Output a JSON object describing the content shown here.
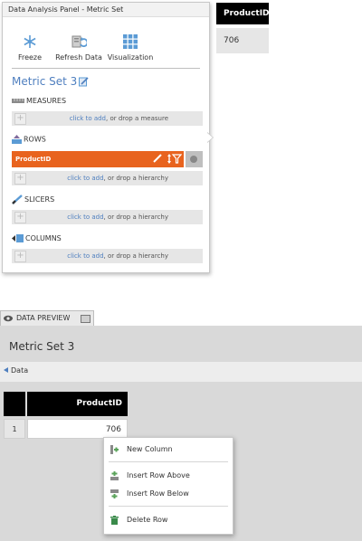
{
  "panel": {
    "title": "Data Analysis Panel - Metric Set",
    "toolbar": [
      {
        "label": "Freeze",
        "icon": "snowflake-icon"
      },
      {
        "label": "Refresh Data",
        "icon": "refresh-data-icon"
      },
      {
        "label": "Visualization",
        "icon": "visualization-grid-icon"
      }
    ],
    "metric_set_name": "Metric Set 3",
    "sections": {
      "measures": {
        "label": "MEASURES",
        "link": "click to add",
        "rest": ", or drop a measure"
      },
      "rows": {
        "label": "ROWS",
        "link": "click to add",
        "rest": ", or drop a hierarchy",
        "item": "ProductID"
      },
      "slicers": {
        "label": "SLICERS",
        "link": "click to add",
        "rest": ", or drop a hierarchy"
      },
      "columns": {
        "label": "COLUMNS",
        "link": "click to add",
        "rest": ", or drop a hierarchy"
      }
    },
    "accent": "#e8631e",
    "link_color": "#4f7fbf"
  },
  "mini_table": {
    "header": "ProductID",
    "value": "706"
  },
  "data_preview": {
    "tab_label": "DATA PREVIEW",
    "title": "Metric Set 3",
    "data_link": "Data",
    "grid": {
      "header": "ProductID",
      "rows": [
        {
          "num": "1",
          "value": "706"
        }
      ]
    }
  },
  "context_menu": {
    "items": [
      "New Column",
      "Insert Row Above",
      "Insert Row Below",
      "Delete Row"
    ]
  }
}
